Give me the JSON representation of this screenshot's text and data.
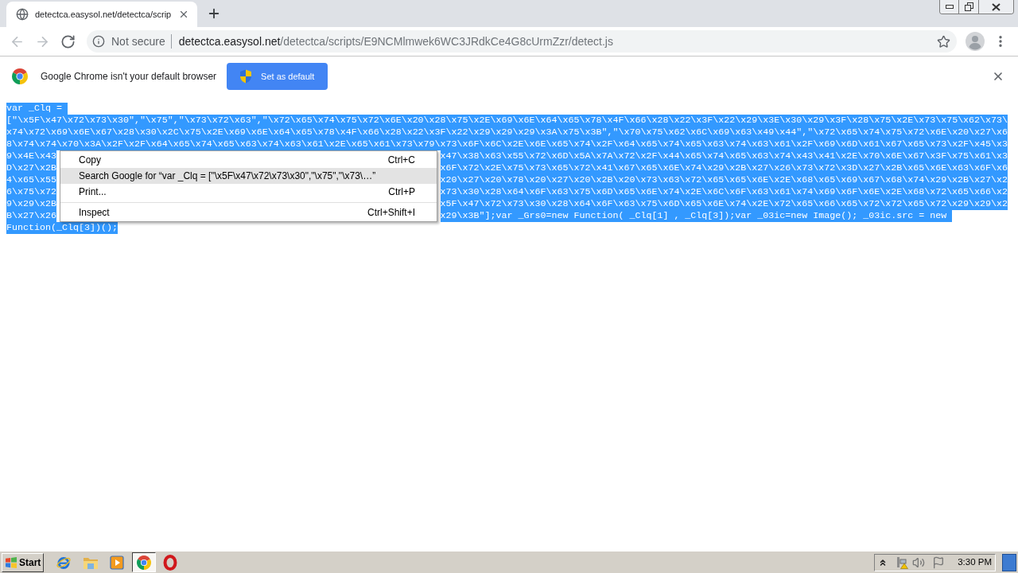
{
  "tabs": [
    {
      "title": "detectca.easysol.net/detectca/scrip",
      "selected": true
    }
  ],
  "toolbar": {
    "nav_buttons": [
      {
        "kind": "back",
        "disabled": true
      },
      {
        "kind": "forward",
        "disabled": true
      },
      {
        "kind": "reload",
        "disabled": false
      }
    ],
    "security_label": "Not secure",
    "url_host": "detectca.easysol.net",
    "url_path": "/detectca/scripts/E9NCMlmwek6WC3JRdkCe4G8cUrmZzr/detect.js"
  },
  "infobar": {
    "message": "Google Chrome isn't your default browser",
    "button": "Set as default"
  },
  "page": {
    "selected": true,
    "lines": [
      {
        "segments": [
          "var _Clq = "
        ]
      },
      {
        "segments": [
          "[\"\\x5F\\x47\\x72\\x73\\x30\",\"\\x75\",\"\\x73\\x72\\x63\",\"\\x72\\x65\\x74\\x75\\x72\\x6E\\x20\\x28\\x75\\x2E\\x69\\x6E\\x64\\x65\\x78\\x4F\\x66\\x28\\x22\\x3F\\x22\\x29\\x3E\\x30\\x29\\x3F\\x28\\x75\\x2E\\x73\\x75\\x62\\x73\\"
        ]
      },
      {
        "segments": [
          "x74\\x72\\x69\\x6E\\x67\\x28\\x30\\x2C\\x75\\x2E\\x69\\x6E\\x64\\x65\\x78\\x4F\\x66\\x28\\x22\\x3F\\x22\\x29\\x29\\x29\\x3A\\x75\\x3B\",\"\\x70\\x75\\x62\\x6C\\x69\\x63\\x49\\x44\",\"\\x72\\x65\\x74\\x75\\x72\\x6E\\x20\\x27\\x6"
        ]
      },
      {
        "segments": [
          "8\\x74\\x74\\x70\\x3A\\x2F\\x2F\\x64\\x65\\x74\\x65\\x63\\x74\\x63\\x61\\x2E\\x65\\x61\\x73\\x79\\x73\\x6F\\x6C\\x2E\\x6E\\x65\\x74\\x2F\\x64\\x65\\x74\\x65\\x63\\x74\\x63\\x61\\x2F\\x69\\x6D\\x61\\x67\\x65\\x73\\x2F\\x45\\x3"
        ]
      },
      {
        "segments": [
          "9\\x4E\\x43",
          "x47\\x38\\x63\\x55\\x72\\x6D\\x5A\\x7A\\x72\\x2F\\x44\\x65\\x74\\x65\\x63\\x74\\x43\\x41\\x2E\\x70\\x6E\\x67\\x3F\\x75\\x61\\x3"
        ]
      },
      {
        "segments": [
          "D\\x27\\x2B",
          "x6F\\x72\\x2E\\x75\\x73\\x65\\x72\\x41\\x67\\x65\\x6E\\x74\\x29\\x2B\\x27\\x26\\x73\\x72\\x3D\\x27\\x2B\\x65\\x6E\\x63\\x6F\\x6"
        ]
      },
      {
        "segments": [
          "4\\x65\\x55",
          "x20\\x27\\x20\\x78\\x20\\x27\\x20\\x2B\\x20\\x73\\x63\\x72\\x65\\x65\\x6E\\x2E\\x68\\x65\\x69\\x67\\x68\\x74\\x29\\x2B\\x27\\x2"
        ]
      },
      {
        "segments": [
          "6\\x75\\x72",
          "x73\\x30\\x28\\x64\\x6F\\x63\\x75\\x6D\\x65\\x6E\\x74\\x2E\\x6C\\x6F\\x63\\x61\\x74\\x69\\x6F\\x6E\\x2E\\x68\\x72\\x65\\x66\\x2"
        ]
      },
      {
        "segments": [
          "9\\x29\\x2B",
          "x5F\\x47\\x72\\x73\\x30\\x28\\x64\\x6F\\x63\\x75\\x6D\\x65\\x6E\\x74\\x2E\\x72\\x65\\x66\\x65\\x72\\x72\\x65\\x72\\x29\\x29\\x2"
        ]
      },
      {
        "segments": [
          "B\\x27\\x26",
          "x29\\x3B\"];var _Grs0=new Function( _Clq[1] , _Clq[3]);var _03ic=new Image(); _03ic.src = new "
        ]
      },
      {
        "segments": [
          "Function(_Clq[3])();"
        ]
      }
    ]
  },
  "context_menu": {
    "items": [
      {
        "kind": "item",
        "label": "Copy",
        "shortcut": "Ctrl+C",
        "selected": false
      },
      {
        "kind": "item",
        "label": "Search Google for “var _Clq = [\"\\x5F\\x47\\x72\\x73\\x30\",\"\\x75\",\"\\x73\\…”",
        "selected": true
      },
      {
        "kind": "item",
        "label": "Print...",
        "shortcut": "Ctrl+P",
        "selected": false
      },
      {
        "kind": "separator"
      },
      {
        "kind": "item",
        "label": "Inspect",
        "shortcut": "Ctrl+Shift+I",
        "selected": false
      }
    ]
  },
  "taskbar": {
    "start": "Start",
    "apps": [
      {
        "selected": false
      },
      {
        "selected": false
      },
      {
        "selected": false
      },
      {
        "selected": true
      },
      {
        "selected": false
      }
    ],
    "clock": "3:30 PM"
  }
}
